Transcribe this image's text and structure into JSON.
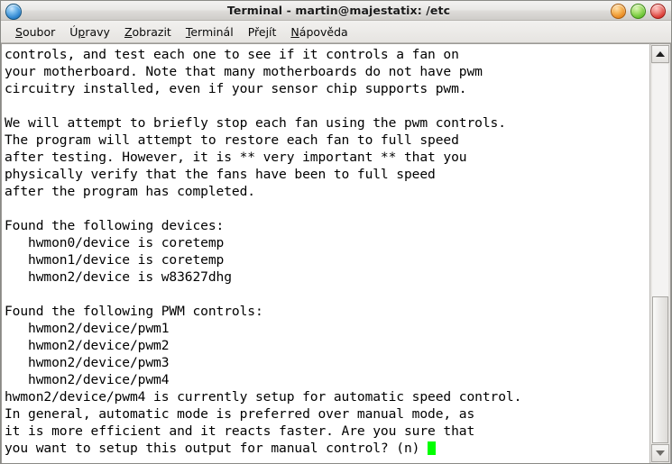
{
  "window": {
    "title": "Terminal - martin@majestatix: /etc",
    "app_icon": "blue-orb-icon",
    "buttons": {
      "minimize": "minimize-button",
      "maximize": "maximize-button",
      "close": "close-button"
    }
  },
  "menubar": {
    "items": [
      {
        "label": "Soubor",
        "mnemonic_index": 0
      },
      {
        "label": "Úpravy",
        "mnemonic_index": 1
      },
      {
        "label": "Zobrazit",
        "mnemonic_index": 0
      },
      {
        "label": "Terminál",
        "mnemonic_index": 0
      },
      {
        "label": "Přejít",
        "mnemonic_index": 3
      },
      {
        "label": "Nápověda",
        "mnemonic_index": 0
      }
    ]
  },
  "terminal": {
    "output": "controls, and test each one to see if it controls a fan on\nyour motherboard. Note that many motherboards do not have pwm\ncircuitry installed, even if your sensor chip supports pwm.\n\nWe will attempt to briefly stop each fan using the pwm controls.\nThe program will attempt to restore each fan to full speed\nafter testing. However, it is ** very important ** that you\nphysically verify that the fans have been to full speed\nafter the program has completed.\n\nFound the following devices:\n   hwmon0/device is coretemp\n   hwmon1/device is coretemp\n   hwmon2/device is w83627dhg\n\nFound the following PWM controls:\n   hwmon2/device/pwm1\n   hwmon2/device/pwm2\n   hwmon2/device/pwm3\n   hwmon2/device/pwm4\nhwmon2/device/pwm4 is currently setup for automatic speed control.\nIn general, automatic mode is preferred over manual mode, as\nit is more efficient and it reacts faster. Are you sure that\nyou want to setup this output for manual control? (n) ",
    "cursor_color": "#00ff00",
    "background_color": "#ffffff",
    "foreground_color": "#000000"
  },
  "scrollbar": {
    "up_arrow": "scroll-up-icon",
    "down_arrow": "scroll-down-icon",
    "thumb": "scrollbar-thumb"
  }
}
